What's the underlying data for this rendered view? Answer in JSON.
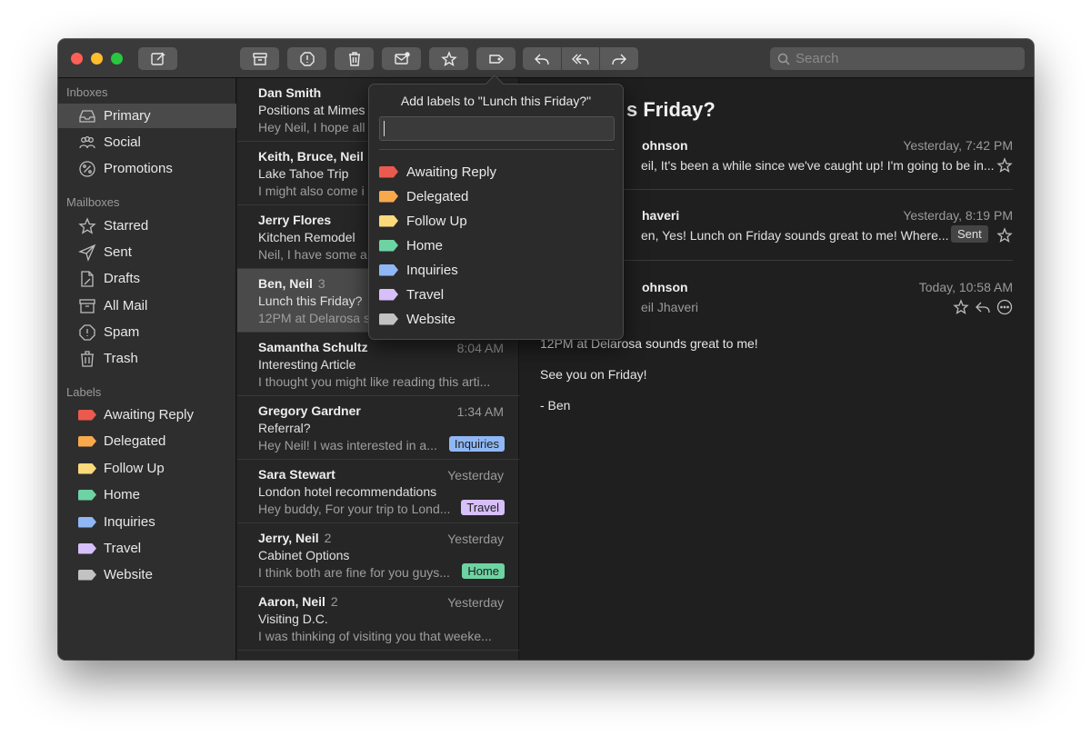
{
  "colors": {
    "awaiting_reply": "#ea5a4e",
    "delegated": "#f7a94c",
    "follow_up": "#fcd97a",
    "home": "#6ed3a2",
    "inquiries": "#8fb7f5",
    "travel": "#d6bffb",
    "website": "#c2c2c2"
  },
  "toolbar": {
    "compose_icon": "compose-icon",
    "archive_icon": "archive-icon",
    "spam_icon": "spam-icon",
    "trash_icon": "trash-icon",
    "mark_icon": "envelope-icon",
    "star_icon": "star-icon",
    "label_icon": "tag-icon",
    "reply_icon": "reply-icon",
    "reply_all_icon": "reply-all-icon",
    "forward_icon": "forward-icon",
    "search_placeholder": "Search"
  },
  "sidebar": {
    "inboxes_header": "Inboxes",
    "inboxes": [
      {
        "label": "Primary",
        "icon": "inbox-icon"
      },
      {
        "label": "Social",
        "icon": "people-icon"
      },
      {
        "label": "Promotions",
        "icon": "percent-icon"
      }
    ],
    "mailboxes_header": "Mailboxes",
    "mailboxes": [
      {
        "label": "Starred",
        "icon": "star-icon"
      },
      {
        "label": "Sent",
        "icon": "send-icon"
      },
      {
        "label": "Drafts",
        "icon": "draft-icon"
      },
      {
        "label": "All Mail",
        "icon": "archive-icon"
      },
      {
        "label": "Spam",
        "icon": "spam-icon"
      },
      {
        "label": "Trash",
        "icon": "trash-icon"
      }
    ],
    "labels_header": "Labels",
    "labels": [
      {
        "label": "Awaiting Reply"
      },
      {
        "label": "Delegated"
      },
      {
        "label": "Follow Up"
      },
      {
        "label": "Home"
      },
      {
        "label": "Inquiries"
      },
      {
        "label": "Travel"
      },
      {
        "label": "Website"
      }
    ]
  },
  "messages": [
    {
      "from": "Dan Smith",
      "count": "",
      "time": "",
      "subject": "Positions at Mimes",
      "preview": "Hey Neil, I hope all",
      "badge": ""
    },
    {
      "from": "Keith, Bruce, Neil",
      "count": "",
      "time": "",
      "subject": "Lake Tahoe Trip",
      "preview": "I might also come i",
      "badge": ""
    },
    {
      "from": "Jerry Flores",
      "count": "",
      "time": "",
      "subject": "Kitchen Remodel",
      "preview": "Neil, I have some a",
      "badge": ""
    },
    {
      "from": "Ben, Neil",
      "count": "3",
      "time": "",
      "subject": "Lunch this Friday?",
      "preview": "12PM at Delarosa s",
      "badge": ""
    },
    {
      "from": "Samantha Schultz",
      "count": "",
      "time": "8:04 AM",
      "subject": "Interesting Article",
      "preview": "I thought you might like reading this arti...",
      "badge": ""
    },
    {
      "from": "Gregory Gardner",
      "count": "",
      "time": "1:34 AM",
      "subject": "Referral?",
      "preview": "Hey Neil! I was interested in a...",
      "badge": "Inquiries"
    },
    {
      "from": "Sara Stewart",
      "count": "",
      "time": "Yesterday",
      "subject": "London hotel recommendations",
      "preview": "Hey buddy, For your trip to Lond...",
      "badge": "Travel"
    },
    {
      "from": "Jerry, Neil",
      "count": "2",
      "time": "Yesterday",
      "subject": "Cabinet Options",
      "preview": "I think both are fine for you guys...",
      "badge": "Home"
    },
    {
      "from": "Aaron, Neil",
      "count": "2",
      "time": "Yesterday",
      "subject": "Visiting D.C.",
      "preview": "I was thinking of visiting you that weeke...",
      "badge": ""
    }
  ],
  "reader": {
    "subject": "s Friday?",
    "thread": [
      {
        "name": "ohnson",
        "date": "Yesterday, 7:42 PM",
        "snippet": "eil, It's been a while since we've caught up! I'm going to be in..."
      },
      {
        "name": "haveri",
        "date": "Yesterday, 8:19 PM",
        "snippet": "en, Yes! Lunch on Friday sounds great to me! Where...",
        "badge": "Sent"
      },
      {
        "name": "ohnson",
        "date": "Today, 10:58 AM",
        "to": "eil Jhaveri"
      }
    ],
    "body": [
      "12PM at Delarosa sounds great to me!",
      "See you on Friday!",
      "- Ben"
    ]
  },
  "popover": {
    "title": "Add labels to \"Lunch this Friday?\"",
    "input_value": "",
    "labels": [
      "Awaiting Reply",
      "Delegated",
      "Follow Up",
      "Home",
      "Inquiries",
      "Travel",
      "Website"
    ]
  }
}
